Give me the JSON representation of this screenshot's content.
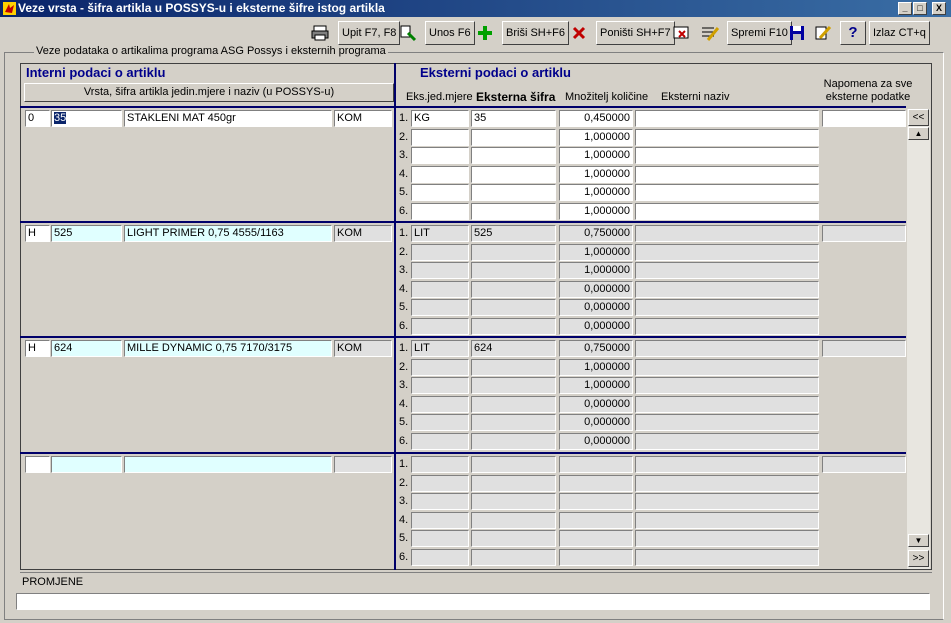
{
  "window": {
    "title": "Veze vrsta - šifra artikla u POSSYS-u i eksterne šifre istog artikla",
    "minimize": "_",
    "maximize": "□",
    "close": "X"
  },
  "toolbar": {
    "upit": "Upit F7, F8",
    "unos": "Unos F6",
    "brisi": "Briši  SH+F6",
    "ponisti": "Poništi SH+F7",
    "spremi": "Spremi F10",
    "izlaz": "Izlaz CT+q",
    "help": "?"
  },
  "group_label": "Veze podataka o artikalima programa  ASG Possys i eksternih programa",
  "internal": {
    "header": "Interni podaci o  artiklu",
    "subheader": "Vrsta, šifra artikla jedin.mjere  i naziv (u POSSYS-u)"
  },
  "external": {
    "header": "Eksterni podaci o artiklu",
    "col_jm": "Eks.jed.mjere",
    "col_sifra": "Eksterna šifra",
    "col_mnoz": "Množitelj količine",
    "col_naziv": "Eksterni naziv",
    "col_nap_1": "Napomena za sve",
    "col_nap_2": "eksterne podatke"
  },
  "records": [
    {
      "vrsta": "0",
      "sifra": "35",
      "naziv": "STAKLENI MAT 450gr",
      "jm": "KOM",
      "rows": [
        {
          "num": "1.",
          "jm": "KG",
          "sifra": "35",
          "mnoz": "0,450000",
          "naziv": ""
        },
        {
          "num": "2.",
          "jm": "",
          "sifra": "",
          "mnoz": "1,000000",
          "naziv": ""
        },
        {
          "num": "3.",
          "jm": "",
          "sifra": "",
          "mnoz": "1,000000",
          "naziv": ""
        },
        {
          "num": "4.",
          "jm": "",
          "sifra": "",
          "mnoz": "1,000000",
          "naziv": ""
        },
        {
          "num": "5.",
          "jm": "",
          "sifra": "",
          "mnoz": "1,000000",
          "naziv": ""
        },
        {
          "num": "6.",
          "jm": "",
          "sifra": "",
          "mnoz": "1,000000",
          "naziv": ""
        }
      ]
    },
    {
      "vrsta": "H",
      "sifra": "525",
      "naziv": "LIGHT PRIMER 0,75  4555/1163",
      "jm": "KOM",
      "rows": [
        {
          "num": "1.",
          "jm": "LIT",
          "sifra": "525",
          "mnoz": "0,750000",
          "naziv": ""
        },
        {
          "num": "2.",
          "jm": "",
          "sifra": "",
          "mnoz": "1,000000",
          "naziv": ""
        },
        {
          "num": "3.",
          "jm": "",
          "sifra": "",
          "mnoz": "1,000000",
          "naziv": ""
        },
        {
          "num": "4.",
          "jm": "",
          "sifra": "",
          "mnoz": "0,000000",
          "naziv": ""
        },
        {
          "num": "5.",
          "jm": "",
          "sifra": "",
          "mnoz": "0,000000",
          "naziv": ""
        },
        {
          "num": "6.",
          "jm": "",
          "sifra": "",
          "mnoz": "0,000000",
          "naziv": ""
        }
      ]
    },
    {
      "vrsta": "H",
      "sifra": "624",
      "naziv": "MILLE DYNAMIC 0,75 7170/3175",
      "jm": "KOM",
      "rows": [
        {
          "num": "1.",
          "jm": "LIT",
          "sifra": "624",
          "mnoz": "0,750000",
          "naziv": ""
        },
        {
          "num": "2.",
          "jm": "",
          "sifra": "",
          "mnoz": "1,000000",
          "naziv": ""
        },
        {
          "num": "3.",
          "jm": "",
          "sifra": "",
          "mnoz": "1,000000",
          "naziv": ""
        },
        {
          "num": "4.",
          "jm": "",
          "sifra": "",
          "mnoz": "0,000000",
          "naziv": ""
        },
        {
          "num": "5.",
          "jm": "",
          "sifra": "",
          "mnoz": "0,000000",
          "naziv": ""
        },
        {
          "num": "6.",
          "jm": "",
          "sifra": "",
          "mnoz": "0,000000",
          "naziv": ""
        }
      ]
    },
    {
      "vrsta": "",
      "sifra": "",
      "naziv": "",
      "jm": "",
      "rows": [
        {
          "num": "1.",
          "jm": "",
          "sifra": "",
          "mnoz": "",
          "naziv": ""
        },
        {
          "num": "2.",
          "jm": "",
          "sifra": "",
          "mnoz": "",
          "naziv": ""
        },
        {
          "num": "3.",
          "jm": "",
          "sifra": "",
          "mnoz": "",
          "naziv": ""
        },
        {
          "num": "4.",
          "jm": "",
          "sifra": "",
          "mnoz": "",
          "naziv": ""
        },
        {
          "num": "5.",
          "jm": "",
          "sifra": "",
          "mnoz": "",
          "naziv": ""
        },
        {
          "num": "6.",
          "jm": "",
          "sifra": "",
          "mnoz": "",
          "naziv": ""
        }
      ]
    }
  ],
  "scroll": {
    "top": "<<",
    "up": "▲",
    "down": "▼",
    "bottom": ">>"
  },
  "promjene": {
    "label": "PROMJENE",
    "value": ""
  }
}
